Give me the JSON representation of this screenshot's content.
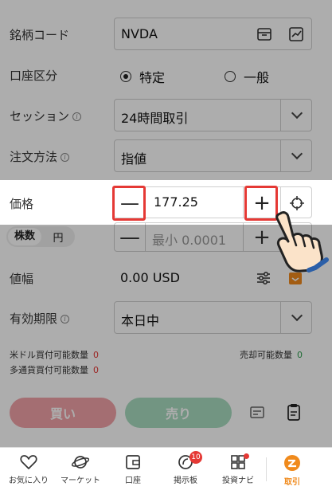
{
  "symbol": {
    "label": "銘柄コード",
    "value": "NVDA"
  },
  "account": {
    "label": "口座区分",
    "option_specific": "特定",
    "option_general": "一般",
    "selected": "特定"
  },
  "session": {
    "label": "セッション",
    "value": "24時間取引"
  },
  "order_method": {
    "label": "注文方法",
    "value": "指値"
  },
  "price": {
    "label": "価格",
    "minus": "—",
    "value": "177.25",
    "plus": "+"
  },
  "quantity": {
    "unit_shares": "株数",
    "unit_yen": "円",
    "minus": "—",
    "placeholder": "最小 0.0001",
    "plus": "+"
  },
  "range": {
    "label": "値幅",
    "value": "0.00 USD"
  },
  "expiry": {
    "label": "有効期限",
    "value": "本日中"
  },
  "buying_power": {
    "usd_label": "米ドル買付可能数量",
    "usd_value": "0",
    "multi_label": "多通貨買付可能数量",
    "multi_value": "0",
    "sell_label": "売却可能数量",
    "sell_value": "0"
  },
  "actions": {
    "buy": "買い",
    "sell": "売り"
  },
  "tabs": [
    {
      "label": "お気に入り",
      "icon": "heart-icon"
    },
    {
      "label": "マーケット",
      "icon": "planet-icon"
    },
    {
      "label": "口座",
      "icon": "wallet-icon"
    },
    {
      "label": "掲示板",
      "icon": "board-icon",
      "badge": "10"
    },
    {
      "label": "投資ナビ",
      "icon": "grid-icon"
    },
    {
      "label": "取引",
      "icon": "trade-icon"
    }
  ],
  "colors": {
    "highlight": "#e53935",
    "buy": "#f2a3a8",
    "sell": "#a9dcc0",
    "accent": "#f08a1c"
  }
}
